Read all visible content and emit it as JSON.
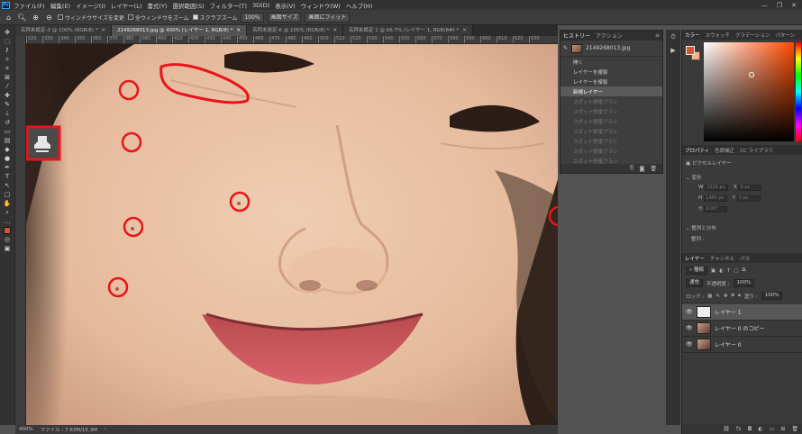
{
  "menubar": {
    "logo": "Ps",
    "items": [
      "ファイル(F)",
      "編集(E)",
      "イメージ(I)",
      "レイヤー(L)",
      "書式(Y)",
      "選択範囲(S)",
      "フィルター(T)",
      "3D(D)",
      "表示(V)",
      "ウィンドウ(W)",
      "ヘルプ(H)"
    ],
    "controls": [
      "—",
      "❐",
      "✕"
    ]
  },
  "options": {
    "resize_windows": "ウィンドウサイズを変更",
    "all_windows_zoom": "全ウィンドウをズーム",
    "scrubby_zoom": "スクラブズーム",
    "zoom_value": "100%",
    "fit_screen": "画面サイズ",
    "fill_screen": "画面にフィット"
  },
  "tabs": [
    {
      "label": "名称未設定-3 @ 100% (RGB/8) *",
      "active": false
    },
    {
      "label": "2149268013.jpg @ 400% (レイヤー 1, RGB/8) *",
      "active": true
    },
    {
      "label": "名称未設定-6 @ 100% (RGB/8) *",
      "active": false
    },
    {
      "label": "名称未設定 1 @ 66.7% (レイヤー 1, RGB/8#) *",
      "active": false
    }
  ],
  "ruler": [
    "320",
    "330",
    "340",
    "350",
    "360",
    "370",
    "380",
    "390",
    "400",
    "410",
    "420",
    "430",
    "440",
    "450",
    "460",
    "470",
    "480",
    "490",
    "500",
    "510",
    "520",
    "530",
    "540",
    "550",
    "560",
    "570",
    "580",
    "590",
    "600",
    "610",
    "620",
    "630"
  ],
  "status": {
    "zoom": "400%",
    "file_info": "ファイル : 7.63M/15.3M",
    "arrow": "›"
  },
  "history": {
    "tabs": [
      "ヒストリー",
      "アクション"
    ],
    "snapshot": "2149268013.jpg",
    "items": [
      {
        "label": "開く",
        "state": "normal"
      },
      {
        "label": "レイヤーを複製",
        "state": "normal"
      },
      {
        "label": "レイヤーを複製",
        "state": "normal"
      },
      {
        "label": "新規レイヤー",
        "state": "sel"
      },
      {
        "label": "スポット修復ブラシ",
        "state": "dim"
      },
      {
        "label": "スポット修復ブラシ",
        "state": "dim"
      },
      {
        "label": "スポット修復ブラシ",
        "state": "dim"
      },
      {
        "label": "スポット修復ブラシ",
        "state": "dim"
      },
      {
        "label": "スポット修復ブラシ",
        "state": "dim"
      },
      {
        "label": "スポット修復ブラシ",
        "state": "dim"
      },
      {
        "label": "スポット修復ブラシ",
        "state": "dim"
      }
    ]
  },
  "color_panel": {
    "tabs": [
      "カラー",
      "スウォッチ",
      "グラデーション",
      "パターン"
    ]
  },
  "properties": {
    "tabs": [
      "プロパティ",
      "色調補正",
      "CC ライブラリ"
    ],
    "type": "ピクセルレイヤー",
    "transform": "変形",
    "w_label": "W",
    "w_value": "2226 px",
    "h_label": "H",
    "h_value": "1484 px",
    "x_label": "X",
    "x_value": "0 px",
    "y_label": "Y",
    "y_value": "0 px",
    "angle": "0.00°",
    "align": "整列と分布",
    "align_sub": "整列 :"
  },
  "layers": {
    "tabs": [
      "レイヤー",
      "チャンネル",
      "パス"
    ],
    "filter_kind": "種類",
    "blend_mode": "通常",
    "opacity_label": "不透明度 :",
    "opacity_value": "100%",
    "lock_label": "ロック :",
    "fill_label": "塗り :",
    "fill_value": "100%",
    "rows": [
      {
        "name": "レイヤー 1",
        "selected": true,
        "transparent": true
      },
      {
        "name": "レイヤー 0 のコピー",
        "selected": false,
        "transparent": false
      },
      {
        "name": "レイヤー 0",
        "selected": false,
        "transparent": false
      }
    ]
  },
  "colors": {
    "annotation": "#e8141b",
    "foreground": "#d2572b",
    "background": "#f2b388"
  }
}
